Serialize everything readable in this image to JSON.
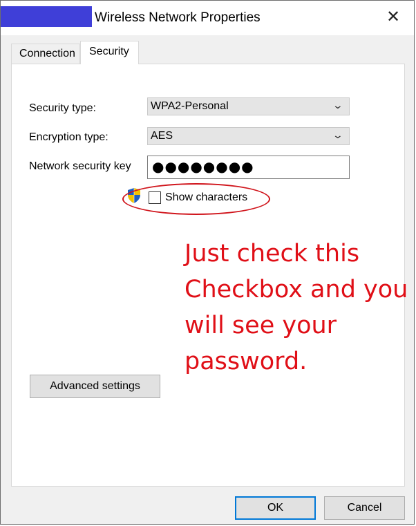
{
  "window": {
    "title": "Wireless Network Properties",
    "close_glyph": "✕"
  },
  "tabs": [
    {
      "label": "Connection",
      "active": false
    },
    {
      "label": "Security",
      "active": true
    }
  ],
  "security": {
    "security_type_label": "Security type:",
    "security_type_value": "WPA2-Personal",
    "encryption_type_label": "Encryption type:",
    "encryption_type_value": "AES",
    "network_key_label": "Network security key",
    "network_key_value": "●●●●●●●●",
    "show_characters_label": "Show characters",
    "show_characters_checked": false
  },
  "annotation": {
    "text": "Just check this Checkbox and you will see your password.",
    "color": "#e00f17"
  },
  "buttons": {
    "advanced_settings": "Advanced settings",
    "ok": "OK",
    "cancel": "Cancel"
  },
  "icons": {
    "shield": "uac-shield-icon",
    "chevron": "chevron-down-icon",
    "close": "close-icon"
  }
}
